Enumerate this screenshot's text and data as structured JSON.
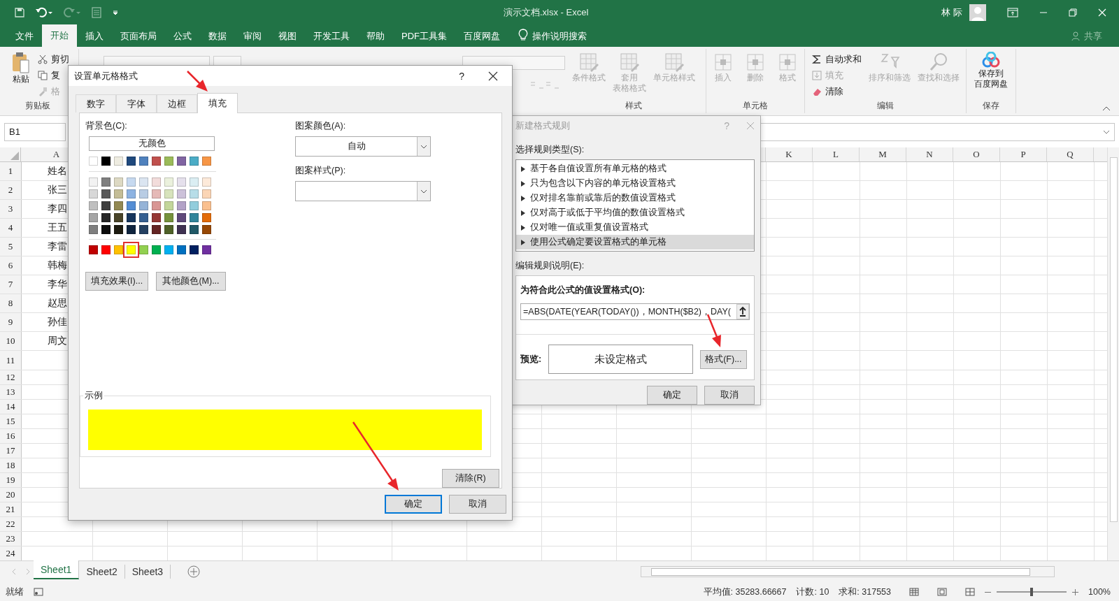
{
  "window": {
    "title": "演示文档.xlsx  -  Excel",
    "user": "林 际"
  },
  "menu_tabs": [
    {
      "label": "文件",
      "selected": false
    },
    {
      "label": "开始",
      "selected": true
    },
    {
      "label": "插入",
      "selected": false
    },
    {
      "label": "页面布局",
      "selected": false
    },
    {
      "label": "公式",
      "selected": false
    },
    {
      "label": "数据",
      "selected": false
    },
    {
      "label": "审阅",
      "selected": false
    },
    {
      "label": "视图",
      "selected": false
    },
    {
      "label": "开发工具",
      "selected": false
    },
    {
      "label": "帮助",
      "selected": false
    },
    {
      "label": "PDF工具集",
      "selected": false
    },
    {
      "label": "百度网盘",
      "selected": false
    }
  ],
  "tell_me": "操作说明搜索",
  "share": "共享",
  "ribbon": {
    "clipboard": {
      "paste": "粘贴",
      "cut": "剪切",
      "copy": "复",
      "painter": "格",
      "label": "剪贴板"
    },
    "styles": {
      "label": "样式",
      "items": [
        {
          "lines": [
            "条件格式"
          ],
          "disabled": true
        },
        {
          "lines": [
            "套用",
            "表格格式"
          ],
          "disabled": true
        },
        {
          "lines": [
            "单元格样式"
          ],
          "disabled": true
        }
      ]
    },
    "cells": {
      "label": "单元格",
      "items": [
        {
          "lines": [
            "插入"
          ],
          "disabled": true
        },
        {
          "lines": [
            "删除"
          ],
          "disabled": true
        },
        {
          "lines": [
            "格式"
          ],
          "disabled": true
        }
      ]
    },
    "editing": {
      "label": "编辑",
      "small": [
        {
          "label": "自动求和",
          "disabled": false
        },
        {
          "label": "填充",
          "disabled": true
        },
        {
          "label": "清除",
          "disabled": false
        }
      ],
      "large": [
        {
          "label": "排序和筛选",
          "disabled": true
        },
        {
          "label": "查找和选择",
          "disabled": true
        }
      ]
    },
    "save": {
      "label": "保存",
      "lines": [
        "保存到",
        "百度网盘"
      ]
    }
  },
  "name_box": "B1",
  "columns": [
    "A",
    "K",
    "L",
    "M",
    "N",
    "O",
    "P",
    "Q"
  ],
  "rows": [
    {
      "number": "1",
      "cell_a": "姓名"
    },
    {
      "number": "2",
      "cell_a": "张三"
    },
    {
      "number": "3",
      "cell_a": "李四"
    },
    {
      "number": "4",
      "cell_a": "王五"
    },
    {
      "number": "5",
      "cell_a": "李雷"
    },
    {
      "number": "6",
      "cell_a": "韩梅"
    },
    {
      "number": "7",
      "cell_a": "李华"
    },
    {
      "number": "8",
      "cell_a": "赵思"
    },
    {
      "number": "9",
      "cell_a": "孙佳"
    },
    {
      "number": "10",
      "cell_a": "周文"
    },
    {
      "number": "11"
    },
    {
      "number": "12"
    },
    {
      "number": "13"
    },
    {
      "number": "14"
    },
    {
      "number": "15"
    },
    {
      "number": "16"
    },
    {
      "number": "17"
    },
    {
      "number": "18"
    },
    {
      "number": "19"
    },
    {
      "number": "20"
    },
    {
      "number": "21"
    },
    {
      "number": "22"
    },
    {
      "number": "23"
    },
    {
      "number": "24"
    }
  ],
  "sheets": [
    {
      "label": "Sheet1",
      "selected": true
    },
    {
      "label": "Sheet2",
      "selected": false
    },
    {
      "label": "Sheet3",
      "selected": false
    }
  ],
  "status": {
    "ready": "就绪",
    "average": "平均值: 35283.66667",
    "count": "计数: 10",
    "sum": "求和: 317553",
    "zoom": {
      "level": 0.5,
      "reading": "100%"
    }
  },
  "format_cells_dialog": {
    "title": "设置单元格格式",
    "help": "?",
    "tabs": [
      {
        "label": "数字",
        "selected": false
      },
      {
        "label": "字体",
        "selected": false
      },
      {
        "label": "边框",
        "selected": false
      },
      {
        "label": "填充",
        "selected": true
      }
    ],
    "background_label": "背景色(C):",
    "no_color": "无颜色",
    "theme_colors": [
      {
        "color": "#ffffff",
        "selected": false
      },
      {
        "color": "#000000",
        "selected": false
      },
      {
        "color": "#eeece1",
        "selected": false
      },
      {
        "color": "#1f497d",
        "selected": false
      },
      {
        "color": "#4f81bd",
        "selected": false
      },
      {
        "color": "#c0504d",
        "selected": false
      },
      {
        "color": "#9bbb59",
        "selected": false
      },
      {
        "color": "#8064a2",
        "selected": false
      },
      {
        "color": "#4bacc6",
        "selected": false
      },
      {
        "color": "#f79646",
        "selected": false
      }
    ],
    "shades": [
      [
        {
          "color": "#f2f2f2",
          "selected": false
        },
        {
          "color": "#7f7f7f",
          "selected": false
        },
        {
          "color": "#ddd9c3",
          "selected": false
        },
        {
          "color": "#c6d9f0",
          "selected": false
        },
        {
          "color": "#dbe5f1",
          "selected": false
        },
        {
          "color": "#f2dcdb",
          "selected": false
        },
        {
          "color": "#ebf1dd",
          "selected": false
        },
        {
          "color": "#e5e0ec",
          "selected": false
        },
        {
          "color": "#dbeef3",
          "selected": false
        },
        {
          "color": "#fdeada",
          "selected": false
        }
      ],
      [
        {
          "color": "#d8d8d8",
          "selected": false
        },
        {
          "color": "#595959",
          "selected": false
        },
        {
          "color": "#c4bd97",
          "selected": false
        },
        {
          "color": "#8db3e2",
          "selected": false
        },
        {
          "color": "#b8cce4",
          "selected": false
        },
        {
          "color": "#e5b9b7",
          "selected": false
        },
        {
          "color": "#d7e3bc",
          "selected": false
        },
        {
          "color": "#ccc1d9",
          "selected": false
        },
        {
          "color": "#b7dde8",
          "selected": false
        },
        {
          "color": "#fbd5b5",
          "selected": false
        }
      ],
      [
        {
          "color": "#bfbfbf",
          "selected": false
        },
        {
          "color": "#3f3f3f",
          "selected": false
        },
        {
          "color": "#938953",
          "selected": false
        },
        {
          "color": "#548dd4",
          "selected": false
        },
        {
          "color": "#95b3d7",
          "selected": false
        },
        {
          "color": "#d99694",
          "selected": false
        },
        {
          "color": "#c3d69b",
          "selected": false
        },
        {
          "color": "#b2a2c7",
          "selected": false
        },
        {
          "color": "#92cddc",
          "selected": false
        },
        {
          "color": "#fac08f",
          "selected": false
        }
      ],
      [
        {
          "color": "#a5a5a5",
          "selected": false
        },
        {
          "color": "#262626",
          "selected": false
        },
        {
          "color": "#494429",
          "selected": false
        },
        {
          "color": "#17365d",
          "selected": false
        },
        {
          "color": "#366092",
          "selected": false
        },
        {
          "color": "#953734",
          "selected": false
        },
        {
          "color": "#76923c",
          "selected": false
        },
        {
          "color": "#5f497a",
          "selected": false
        },
        {
          "color": "#31859b",
          "selected": false
        },
        {
          "color": "#e36c09",
          "selected": false
        }
      ],
      [
        {
          "color": "#7f7f7f",
          "selected": false
        },
        {
          "color": "#0c0c0c",
          "selected": false
        },
        {
          "color": "#1d1b10",
          "selected": false
        },
        {
          "color": "#0f243e",
          "selected": false
        },
        {
          "color": "#244061",
          "selected": false
        },
        {
          "color": "#632423",
          "selected": false
        },
        {
          "color": "#4f6128",
          "selected": false
        },
        {
          "color": "#3f3151",
          "selected": false
        },
        {
          "color": "#205867",
          "selected": false
        },
        {
          "color": "#974806",
          "selected": false
        }
      ]
    ],
    "standard_colors": [
      {
        "color": "#c00000",
        "selected": false
      },
      {
        "color": "#ff0000",
        "selected": false
      },
      {
        "color": "#ffc000",
        "selected": false
      },
      {
        "color": "#ffff00",
        "selected": true
      },
      {
        "color": "#92d050",
        "selected": false
      },
      {
        "color": "#00b050",
        "selected": false
      },
      {
        "color": "#00b0f0",
        "selected": false
      },
      {
        "color": "#0070c0",
        "selected": false
      },
      {
        "color": "#002060",
        "selected": false
      },
      {
        "color": "#7030a0",
        "selected": false
      }
    ],
    "fill_effects": "填充效果(I)...",
    "more_colors": "其他颜色(M)...",
    "pattern_color_label": "图案颜色(A):",
    "pattern_color": "自动",
    "pattern_style_label": "图案样式(P):",
    "sample_label": "示例",
    "clear": "清除(R)",
    "ok": "确定",
    "cancel": "取消"
  },
  "new_rule_dialog": {
    "title": "新建格式规则",
    "help": "?",
    "rule_type_label": "选择规则类型(S):",
    "rule_types": [
      {
        "label": "基于各自值设置所有单元格的格式",
        "selected": false
      },
      {
        "label": "只为包含以下内容的单元格设置格式",
        "selected": false
      },
      {
        "label": "仅对排名靠前或靠后的数值设置格式",
        "selected": false
      },
      {
        "label": "仅对高于或低于平均值的数值设置格式",
        "selected": false
      },
      {
        "label": "仅对唯一值或重复值设置格式",
        "selected": false
      },
      {
        "label": "使用公式确定要设置格式的单元格",
        "selected": true
      }
    ],
    "description_label": "编辑规则说明(E):",
    "formula_label": "为符合此公式的值设置格式(O):",
    "formula": "=ABS(DATE(YEAR(TODAY())，MONTH($B2)，DAY(",
    "preview_label": "预览:",
    "preview": "未设定格式",
    "format_button": "格式(F)...",
    "ok": "确定",
    "cancel": "取消"
  }
}
